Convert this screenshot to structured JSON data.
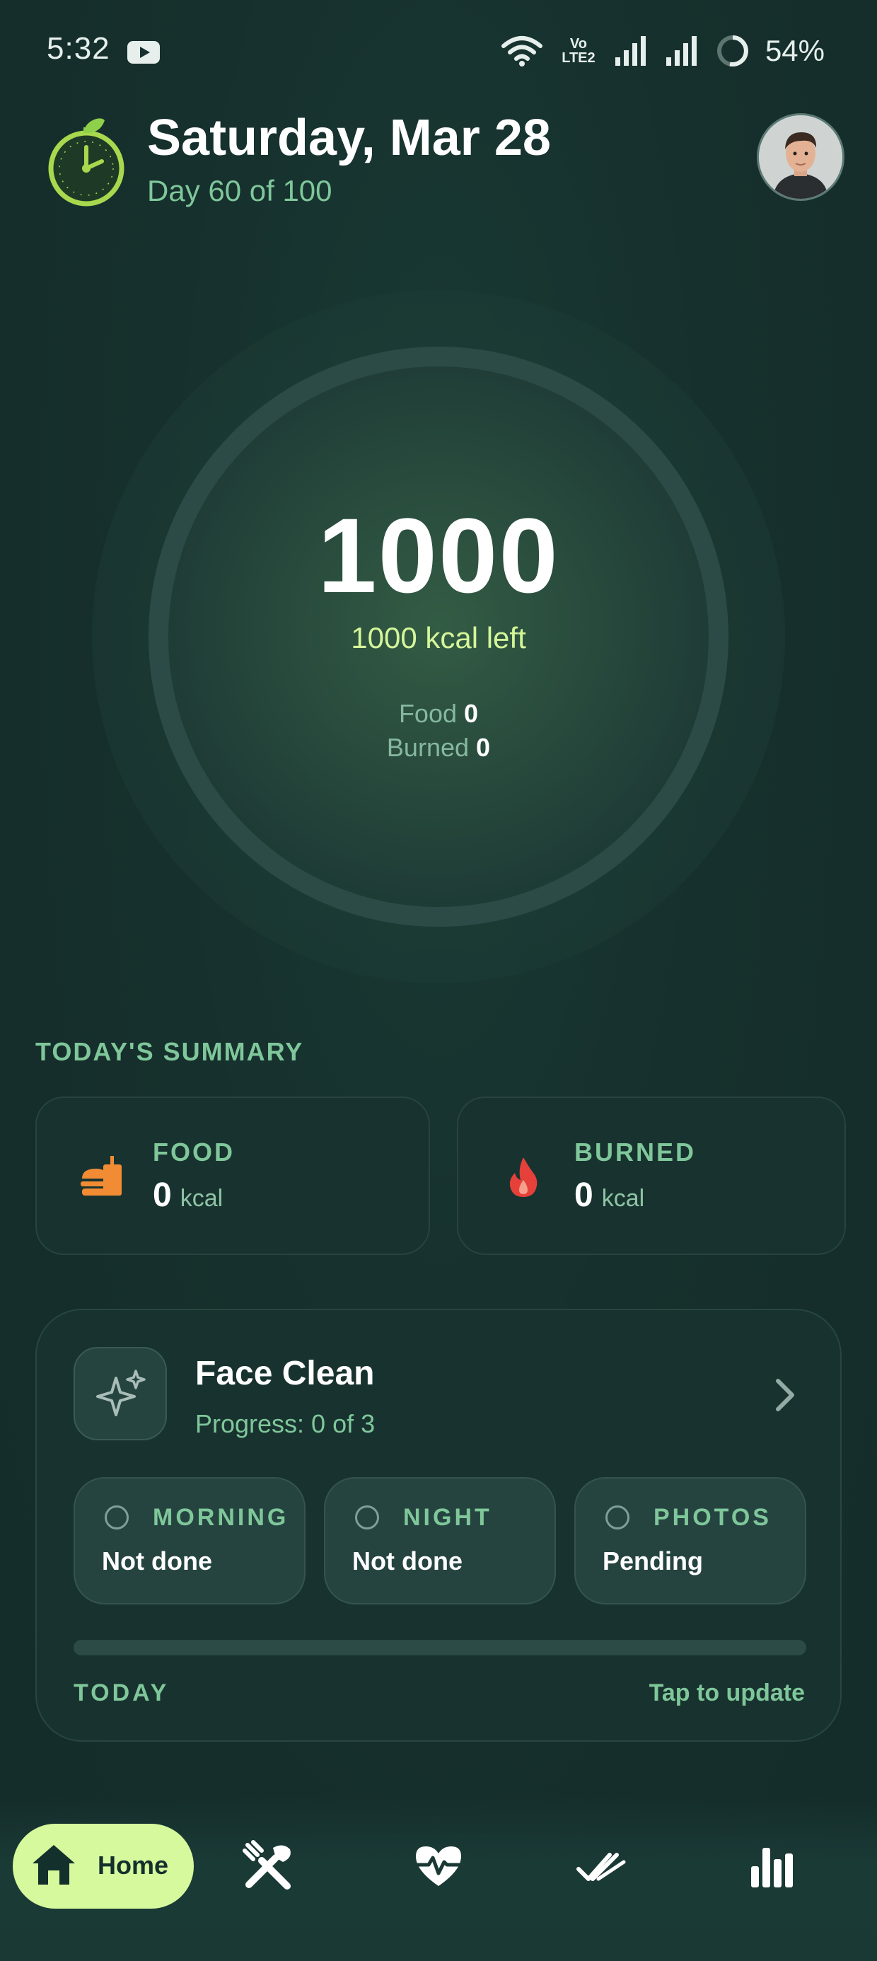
{
  "status_bar": {
    "time": "5:32",
    "volte_line1": "Vo",
    "volte_line2": "LTE2",
    "battery": "54%",
    "icons": [
      "youtube-icon",
      "wifi-icon",
      "volte-icon",
      "signal-icon",
      "signal-icon",
      "battery-icon"
    ]
  },
  "header": {
    "title": "Saturday, Mar 28",
    "subtitle": "Day 60 of 100",
    "logo_icon": "stopwatch-leaf-icon",
    "avatar_icon": "user-avatar"
  },
  "calorie_ring": {
    "value": "1000",
    "left_text": "1000 kcal left",
    "food_label": "Food",
    "food_value": "0",
    "burned_label": "Burned",
    "burned_value": "0",
    "progress_fraction": 0
  },
  "summary": {
    "section_label": "TODAY'S SUMMARY",
    "food": {
      "label": "FOOD",
      "value": "0",
      "unit": "kcal",
      "icon": "fast-food-icon"
    },
    "burned": {
      "label": "BURNED",
      "value": "0",
      "unit": "kcal",
      "icon": "flame-icon"
    }
  },
  "routine": {
    "title": "Face Clean",
    "progress_text": "Progress: 0 of 3",
    "progress_fraction": 0,
    "icon": "sparkles-icon",
    "tasks": [
      {
        "label": "MORNING",
        "status": "Not done"
      },
      {
        "label": "NIGHT",
        "status": "Not done"
      },
      {
        "label": "PHOTOS",
        "status": "Pending"
      }
    ],
    "footer_left": "TODAY",
    "footer_right": "Tap to update"
  },
  "bottom_nav": {
    "home_label": "Home",
    "items": [
      "home-icon",
      "utensils-icon",
      "heart-pulse-icon",
      "double-check-icon",
      "bar-chart-icon"
    ]
  },
  "colors": {
    "background": "#15302e",
    "accent": "#d6f99d",
    "muted_green": "#7fc79a",
    "food_orange": "#f28c34",
    "burn_red": "#e5413a"
  }
}
